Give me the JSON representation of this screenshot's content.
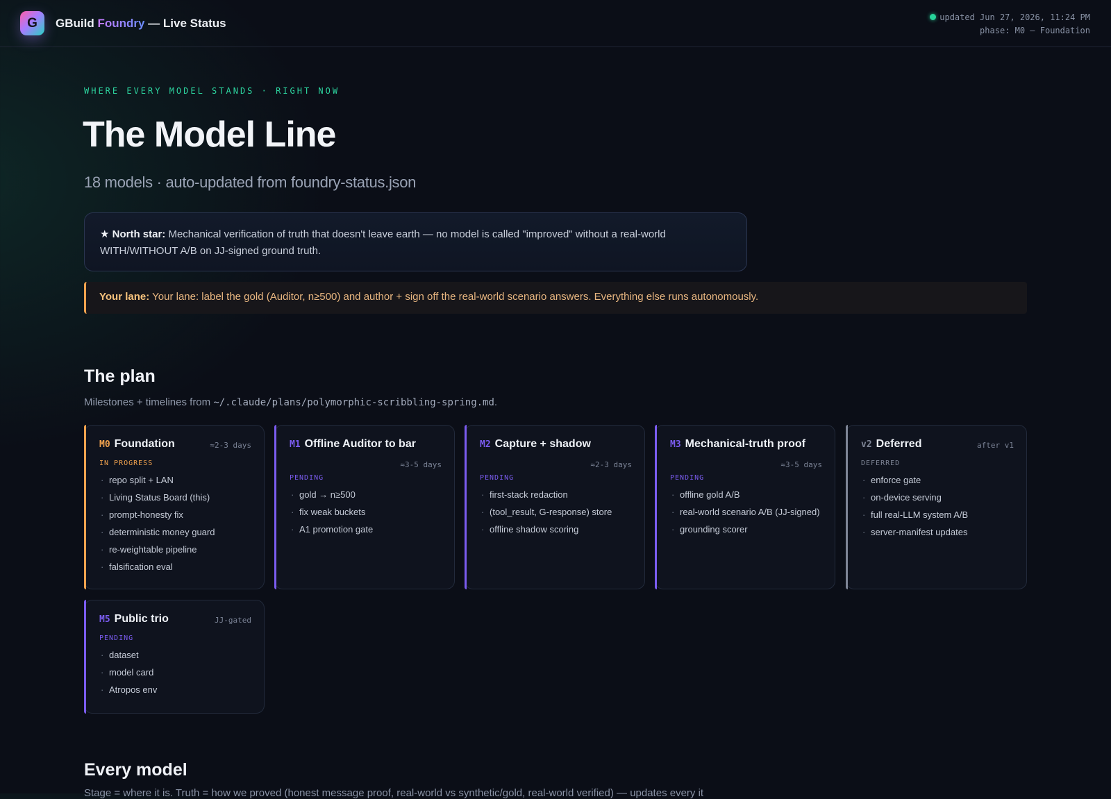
{
  "header": {
    "logo_letter": "G",
    "brand_prefix": "GBuild",
    "brand_accent": "Foundry",
    "brand_suffix": " — Live Status",
    "updated": "updated Jun 27, 2026, 11:24 PM",
    "phase": "phase: M0 — Foundation"
  },
  "hero": {
    "eyebrow": "WHERE EVERY MODEL STANDS · RIGHT NOW",
    "title": "The Model Line",
    "subtitle": "18 models · auto-updated from foundry-status.json"
  },
  "north_star": {
    "label": "★ North star:",
    "text": " Mechanical verification of truth that doesn't leave earth — no model is called \"improved\" without a real-world WITH/WITHOUT A/B on JJ-signed ground truth."
  },
  "lane": {
    "label": "Your lane:",
    "text": " Your lane: label the gold (Auditor, n≥500) and author + sign off the real-world scenario answers. Everything else runs autonomously."
  },
  "plan": {
    "title": "The plan",
    "subtitle_prefix": "Milestones + timelines from ",
    "subtitle_path": "~/.claude/plans/polymorphic-scribbling-spring.md",
    "subtitle_suffix": ".",
    "milestones": [
      {
        "code": "M0",
        "title": "Foundation",
        "duration": "≈2-3 days",
        "state": "IN PROGRESS",
        "items": [
          "repo split + LAN",
          "Living Status Board (this)",
          "prompt-honesty fix",
          "deterministic money guard",
          "re-weightable pipeline",
          "falsification eval"
        ]
      },
      {
        "code": "M1",
        "title": "Offline Auditor to bar",
        "duration": "≈3-5 days",
        "state": "PENDING",
        "items": [
          "gold → n≥500",
          "fix weak buckets",
          "A1 promotion gate"
        ]
      },
      {
        "code": "M2",
        "title": "Capture + shadow",
        "duration": "≈2-3 days",
        "state": "PENDING",
        "items": [
          "first-stack redaction",
          "(tool_result, G-response) store",
          "offline shadow scoring"
        ]
      },
      {
        "code": "M3",
        "title": "Mechanical-truth proof",
        "duration": "≈3-5 days",
        "state": "PENDING",
        "items": [
          "offline gold A/B",
          "real-world scenario A/B (JJ-signed)",
          "grounding scorer"
        ]
      },
      {
        "code": "v2",
        "title": "Deferred",
        "duration": "after v1",
        "state": "DEFERRED",
        "items": [
          "enforce gate",
          "on-device serving",
          "full real-LLM system A/B",
          "server-manifest updates"
        ]
      },
      {
        "code": "M5",
        "title": "Public trio",
        "duration": "JJ-gated",
        "state": "PENDING",
        "items": [
          "dataset",
          "model card",
          "Atropos env"
        ]
      }
    ]
  },
  "every_model": {
    "title": "Every model",
    "subtitle": "Stage = where it is. Truth = how we proved (honest message proof, real-world vs synthetic/gold, real-world verified) — updates every it"
  },
  "colors": {
    "accent_green": "#27d49a",
    "accent_orange": "#f0a24e",
    "accent_purple": "#7b5cf0",
    "accent_gray": "#7e8596"
  }
}
